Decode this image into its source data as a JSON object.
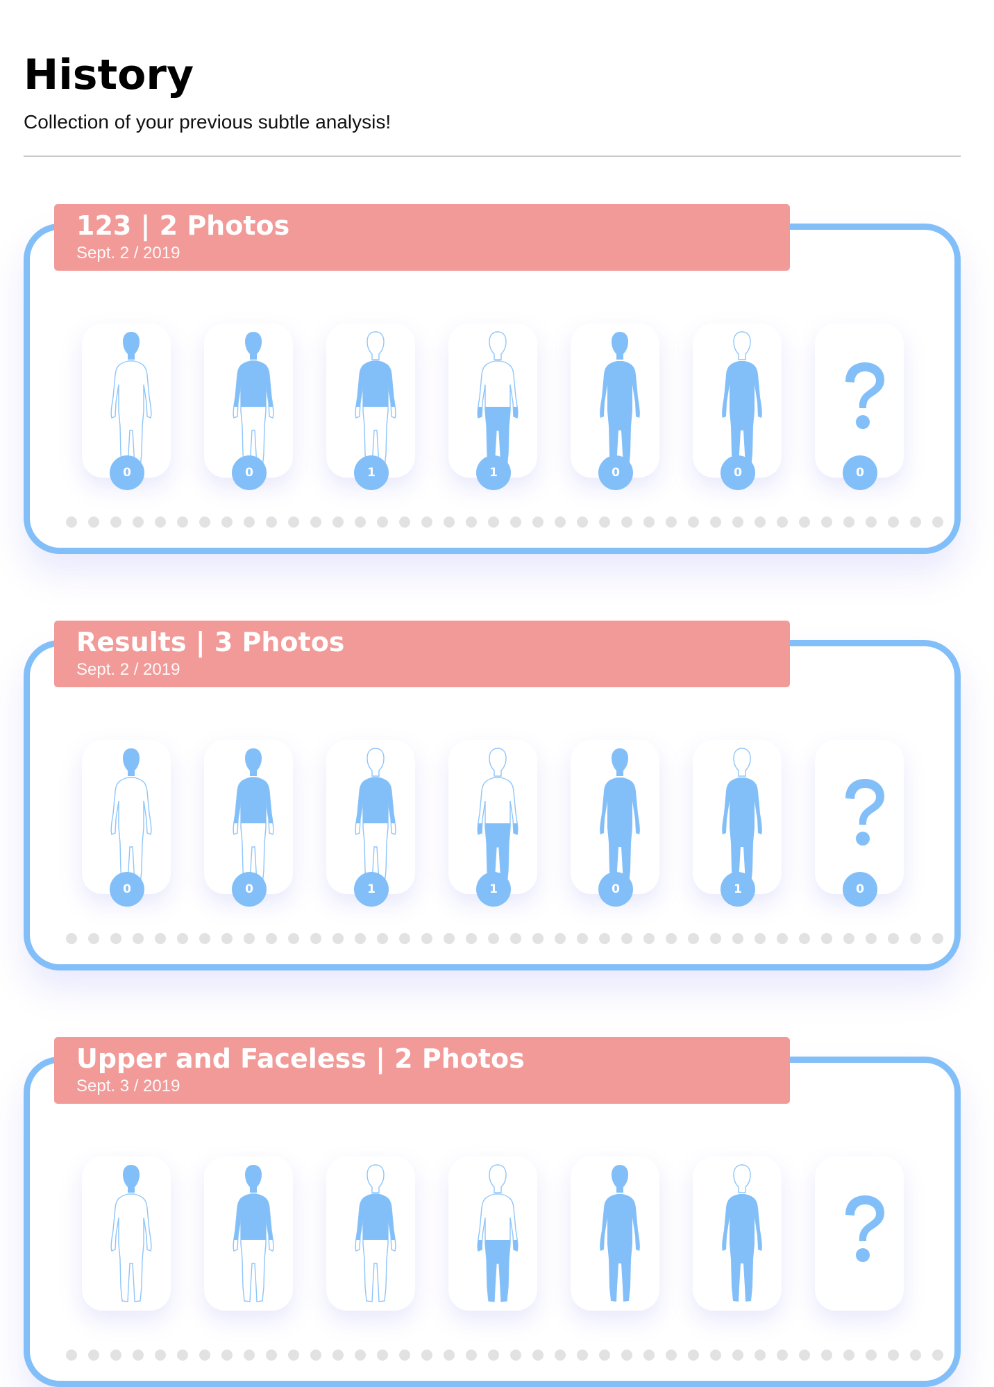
{
  "header": {
    "title": "History",
    "subtitle": "Collection of your previous subtle analysis!"
  },
  "colors": {
    "accent_blue": "#82bff8",
    "banner_pink": "#f19a98",
    "dot_gray": "#e2e2e2"
  },
  "cards": [
    {
      "title": "123 | 2 Photos",
      "date": "Sept. 2 / 2019",
      "figures": [
        {
          "icon": "body-outline-head-filled-icon",
          "count": "0"
        },
        {
          "icon": "body-upper-filled-icon",
          "count": "0"
        },
        {
          "icon": "body-torso-filled-icon",
          "count": "1"
        },
        {
          "icon": "body-lower-filled-icon",
          "count": "1"
        },
        {
          "icon": "body-full-filled-icon",
          "count": "0"
        },
        {
          "icon": "body-faceless-filled-icon",
          "count": "0"
        },
        {
          "icon": "question-mark-icon",
          "count": "0"
        }
      ]
    },
    {
      "title": "Results | 3 Photos",
      "date": "Sept. 2 / 2019",
      "figures": [
        {
          "icon": "body-outline-head-filled-icon",
          "count": "0"
        },
        {
          "icon": "body-upper-filled-icon",
          "count": "0"
        },
        {
          "icon": "body-torso-filled-icon",
          "count": "1"
        },
        {
          "icon": "body-lower-filled-icon",
          "count": "1"
        },
        {
          "icon": "body-full-filled-icon",
          "count": "0"
        },
        {
          "icon": "body-faceless-filled-icon",
          "count": "1"
        },
        {
          "icon": "question-mark-icon",
          "count": "0"
        }
      ]
    },
    {
      "title": "Upper and Faceless | 2 Photos",
      "date": "Sept. 3 / 2019",
      "figures": [
        {
          "icon": "body-outline-head-filled-icon",
          "count": ""
        },
        {
          "icon": "body-upper-filled-icon",
          "count": ""
        },
        {
          "icon": "body-torso-filled-icon",
          "count": ""
        },
        {
          "icon": "body-lower-filled-icon",
          "count": ""
        },
        {
          "icon": "body-full-filled-icon",
          "count": ""
        },
        {
          "icon": "body-faceless-filled-icon",
          "count": ""
        },
        {
          "icon": "question-mark-icon",
          "count": ""
        }
      ]
    }
  ]
}
